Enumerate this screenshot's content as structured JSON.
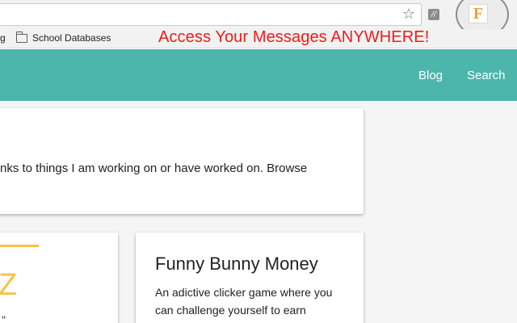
{
  "browser": {
    "bookmarks": {
      "partial_item": "g",
      "folder_label": "School Databases"
    },
    "extension_icon_letter": "F",
    "gray_ext_icon_text": "//",
    "star_glyph": "☆"
  },
  "promo_banner": "Access Your Messages ANYWHERE!",
  "site": {
    "nav": {
      "blog": "Blog",
      "search": "Search"
    },
    "intro_text": "nks to things I am working on or have worked on. Browse",
    "left_card": {
      "logo_partial": "Z",
      "text_partial": "\""
    },
    "project_card": {
      "title": "Funny Bunny Money",
      "description": "An adictive clicker game where you can challenge yourself to earn"
    }
  },
  "colors": {
    "nav_bg": "#4db6ac",
    "promo_text": "#ee1c1c",
    "accent_yellow": "#f6c344",
    "ext_icon": "#e8a23c"
  }
}
